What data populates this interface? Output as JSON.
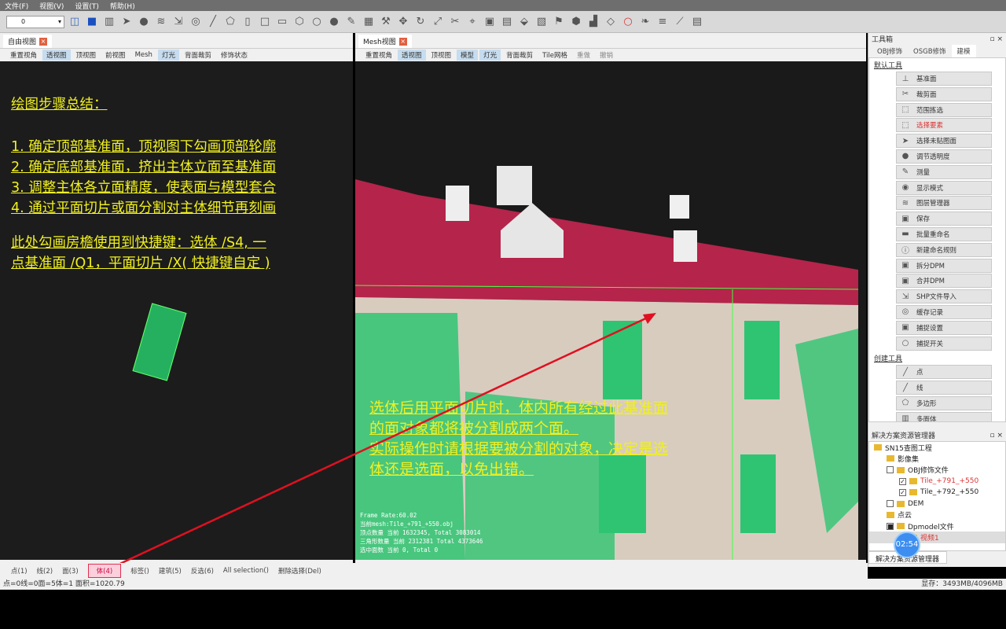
{
  "menu": [
    "文件(F)",
    "视图(V)",
    "设置(T)",
    "帮助(H)"
  ],
  "toolbar": {
    "layer_value": "0"
  },
  "left_view": {
    "tab": "自由视图",
    "buttons": [
      "重置视角",
      "透视图",
      "顶视图",
      "前视图",
      "Mesh",
      "灯光",
      "背面裁剪",
      "修饰状态"
    ],
    "active": [
      "透视图",
      "灯光"
    ],
    "notes": [
      "绘图步骤总结：",
      "1. 确定顶部基准面，顶视图下勾画顶部轮廓",
      "2. 确定底部基准面，挤出主体立面至基准面",
      "3. 调整主体各立面精度，使表面与模型套合",
      "4. 通过平面切片或面分割对主体细节再刻画",
      "此处勾画房檐使用到快捷键：选体 /S4, 一",
      "点基准面 /Q1，平面切片 /X( 快捷键自定 )"
    ]
  },
  "mesh_view": {
    "tab": "Mesh视图",
    "buttons": [
      "重置视角",
      "透视图",
      "顶视图",
      "模型",
      "灯光",
      "背面裁剪",
      "Tile网格",
      "重做",
      "撤销"
    ],
    "active": [
      "透视图",
      "模型",
      "灯光"
    ],
    "caption": [
      "选体后用平面切片时，体内所有经过此基准面",
      "的面对象都将被分割成两个面。",
      "实际操作时请根据要被分割的对象，决定是选",
      "体还是选面，以免出错。"
    ],
    "stats": [
      "Frame Rate:60.02",
      "当前mesh:Tile_+791_+550.obj",
      "顶点数量 当前 1632345, Total 3083014",
      "三角形数量 当前 2312381  Total 4373646",
      "选中面数 当前 0, Total 0"
    ]
  },
  "toolbox": {
    "title": "工具箱",
    "tabs": [
      "OBJ修饰",
      "OSGB修饰",
      "建模"
    ],
    "active_tab": "建模",
    "sections": [
      {
        "label": "默认工具",
        "items": [
          [
            "基准面",
            "⊥"
          ],
          [
            "裁剪面",
            "✂"
          ],
          [
            "范围拣选",
            "⬚"
          ],
          [
            "选择要素",
            "⬚"
          ],
          [
            "选择未贴图面",
            "➤"
          ],
          [
            "调节透明度",
            "●"
          ],
          [
            "测量",
            "✎"
          ],
          [
            "显示模式",
            "◉"
          ],
          [
            "图层管理器",
            "≋"
          ],
          [
            "保存",
            "▣"
          ],
          [
            "批量重命名",
            "▬"
          ],
          [
            "新建命名规则",
            "ⓘ"
          ],
          [
            "拆分DPM",
            "▣"
          ],
          [
            "合并DPM",
            "▣"
          ],
          [
            "SHP文件导入",
            "⇲"
          ],
          [
            "缓存记录",
            "◎"
          ],
          [
            "捕捉设置",
            "▣"
          ],
          [
            "捕捉开关",
            "○"
          ]
        ]
      },
      {
        "label": "创建工具",
        "items": [
          [
            "点",
            "╱"
          ],
          [
            "线",
            "╱"
          ],
          [
            "多边形",
            "⬠"
          ],
          [
            "多面体",
            "▥"
          ]
        ]
      }
    ],
    "highlight": "选择要素"
  },
  "solution": {
    "title": "解决方案资源管理器",
    "tab": "解决方案资源管理器",
    "tree": [
      {
        "label": "SN15查图工程",
        "level": 0,
        "check": null
      },
      {
        "label": "影像集",
        "level": 1,
        "check": null
      },
      {
        "label": "OBJ修饰文件",
        "level": 1,
        "check": false
      },
      {
        "label": "Tile_+791_+550",
        "level": 2,
        "check": true,
        "color": "#d33"
      },
      {
        "label": "Tile_+792_+550",
        "level": 2,
        "check": true
      },
      {
        "label": "DEM",
        "level": 1,
        "check": false
      },
      {
        "label": "点云",
        "level": 1,
        "check": null
      },
      {
        "label": "Dpmodel文件",
        "level": 1,
        "check": "partial"
      },
      {
        "label": "视频1",
        "level": 2,
        "check": true,
        "color": "#d33"
      }
    ],
    "timer": "02:54"
  },
  "selection_bar": {
    "items": [
      "点(1)",
      "线(2)",
      "面(3)",
      "体(4)",
      "标签()",
      "建筑(5)",
      "反选(6)",
      "All selection()",
      "删除选择(Del)"
    ],
    "active": "体(4)"
  },
  "status": {
    "left": "点=0线=0面=5体=1   面积=1020.79",
    "right": "显存：3493MB/4096MB"
  }
}
